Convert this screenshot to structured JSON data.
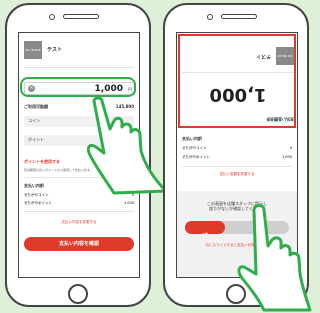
{
  "left_phone": {
    "product_name": "テスト",
    "product_thumb_label": "NO IMAGE",
    "amount_value": "1,000",
    "amount_unit": "円",
    "usage_label": "ご利用可能額",
    "usage_value": "145,800",
    "coin_label": "コイン",
    "point_label": "ポイント",
    "use_points_link": "ポイントを使用する",
    "use_points_note": "有効期限の近いポイントから使用して支払います。",
    "breakdown_title": "支払い内訳",
    "breakdown": [
      {
        "label": "せたがやコイン",
        "value": "0"
      },
      {
        "label": "せたがやポイント",
        "value": "1,000"
      }
    ],
    "change_link": "支払い内容を変更する",
    "confirm_button": "支払い内容を確認"
  },
  "right_phone": {
    "product_name": "テスト",
    "product_thumb_label": "NO IMAGE",
    "amount_value": "1,000",
    "amount_title": "支払い金額合計",
    "breakdown_title": "支払い内訳",
    "breakdown": [
      {
        "label": "せたがやコイン",
        "value": "0"
      },
      {
        "label": "せたがやポイント",
        "value": "1,000"
      }
    ],
    "change_link": "支払い金額を変更する",
    "instruction": "この画面を店舗スタッフに提示し\n誤りがないか確認してください",
    "slide_link": "右にスライドすると支払いが完了します"
  },
  "colors": {
    "accent_red": "#e03a2d",
    "highlight_green": "#2eae4a",
    "background": "#dff0d8"
  }
}
